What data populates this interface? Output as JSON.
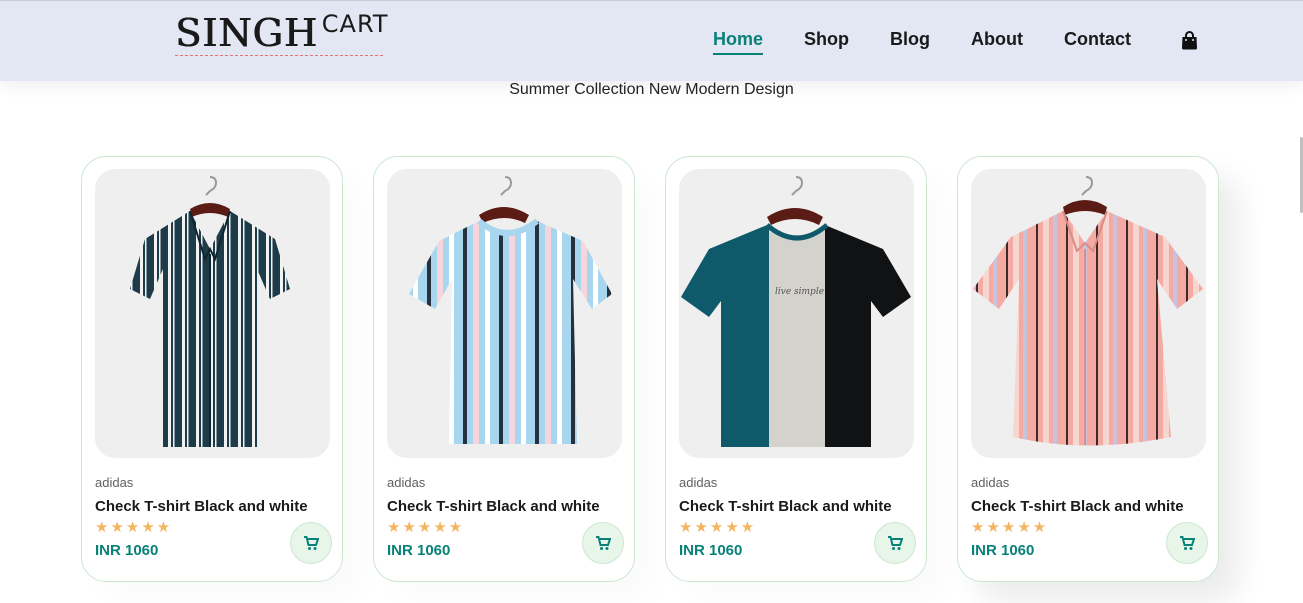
{
  "header": {
    "logo_main": "SINGH",
    "logo_sup": "CART",
    "nav": [
      {
        "label": "Home",
        "active": true
      },
      {
        "label": "Shop",
        "active": false
      },
      {
        "label": "Blog",
        "active": false
      },
      {
        "label": "About",
        "active": false
      },
      {
        "label": "Contact",
        "active": false
      }
    ],
    "bag_icon": "shopping-bag-icon"
  },
  "subtitle": "Summer Collection New Modern Design",
  "products": [
    {
      "brand": "adidas",
      "name": "Check T-shirt Black and white",
      "stars": "★★★★★",
      "price": "INR 1060",
      "image": "teal-striped-shirt"
    },
    {
      "brand": "adidas",
      "name": "Check T-shirt Black and white",
      "stars": "★★★★★",
      "price": "INR 1060",
      "image": "blue-striped-tshirt"
    },
    {
      "brand": "adidas",
      "name": "Check T-shirt Black and white",
      "stars": "★★★★★",
      "price": "INR 1060",
      "image": "colorblock-tshirt"
    },
    {
      "brand": "adidas",
      "name": "Check T-shirt Black and white",
      "stars": "★★★★★",
      "price": "INR 1060",
      "image": "pink-striped-shirt"
    }
  ],
  "colors": {
    "accent": "#088178",
    "header_bg": "#e3e6f3",
    "star": "#f3b562",
    "cart_bg": "#e8f6ea"
  }
}
